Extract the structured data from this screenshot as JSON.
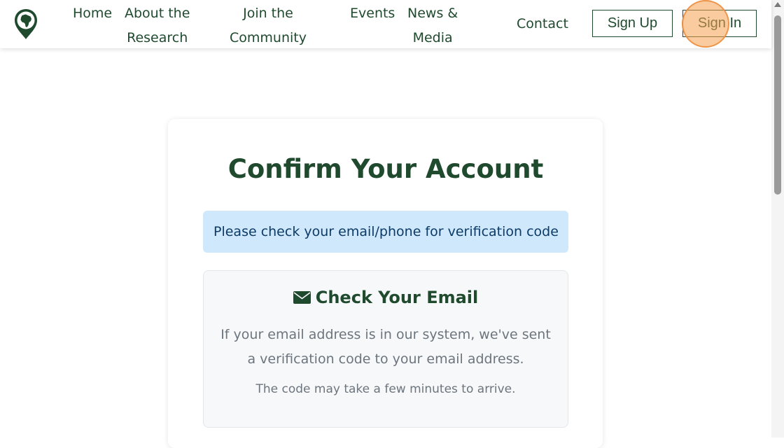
{
  "nav": {
    "links": [
      {
        "label": "Home"
      },
      {
        "label": "About the\nResearch"
      },
      {
        "label": "Join the\nCommunity"
      },
      {
        "label": "Events"
      },
      {
        "label": "News &\nMedia"
      },
      {
        "label": "Contact"
      }
    ],
    "signup_label": "Sign Up",
    "signin_label": "Sign In"
  },
  "card": {
    "title": "Confirm Your Account",
    "alert_text": "Please check your email/phone for verification code",
    "email_section": {
      "heading": "Check Your Email",
      "body": "If your email address is in our system, we've sent a verification code to your email address.",
      "note": "The code may take a few minutes to arrive."
    }
  },
  "colors": {
    "brand": "#1f4a2e",
    "alert_bg": "#cfe8fc",
    "alert_text": "#0d3b66",
    "muted_text": "#6c757d"
  },
  "icons": {
    "logo": "africa-map-pin-icon",
    "email_heading": "envelope-icon"
  }
}
